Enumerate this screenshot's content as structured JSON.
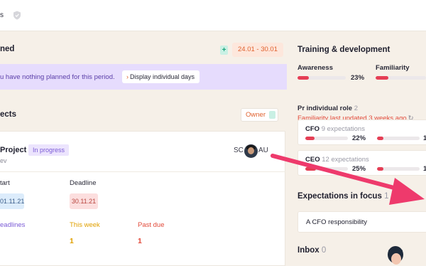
{
  "header": {
    "breadcrumb": "s"
  },
  "planned": {
    "title": "ned",
    "date_range": "24.01 - 30.01",
    "add_label": "+",
    "notice": "u have nothing planned for this period.",
    "display_button": "Display individual days"
  },
  "projects": {
    "title": "ects",
    "owner_filter": "Owner",
    "card": {
      "title": "Project",
      "status": "In progress",
      "subtitle": "ev",
      "member_initials_1": "SC",
      "member_initials_2": "AU",
      "start_label": "tart",
      "start_date": "01.11.21",
      "deadline_label": "Deadline",
      "deadline_date": "30.11.21",
      "stats": [
        {
          "label": "eadlines",
          "value": ""
        },
        {
          "label": "This week",
          "value": "1"
        },
        {
          "label": "Past due",
          "value": "1"
        }
      ]
    }
  },
  "training": {
    "title": "Training & development",
    "awareness_label": "Awareness",
    "awareness_pct": "23%",
    "awareness_value": 0.23,
    "familiarity_label": "Familiarity",
    "familiarity_value": 0.25,
    "familiarity_warning": "Familiarity last updated 3 weeks ago",
    "per_role_label": "Pr individual role",
    "per_role_count": "2",
    "roles": [
      {
        "name": "CFO",
        "expectations": "9 expectations",
        "pct": "22%",
        "value": 0.22,
        "trail": "1"
      },
      {
        "name": "CEO",
        "expectations": "12 expectations",
        "pct": "25%",
        "value": 0.25,
        "trail": "1"
      }
    ]
  },
  "expectations": {
    "title": "Expectations in focus",
    "count": "1",
    "items": [
      "A CFO responsibility"
    ]
  },
  "inbox": {
    "title": "Inbox",
    "count": "0"
  },
  "colors": {
    "accent_orange": "#e0612d",
    "purple": "#7b5bd6",
    "bar_red": "#e53e55",
    "arrow_pink": "#ee3a6c"
  }
}
